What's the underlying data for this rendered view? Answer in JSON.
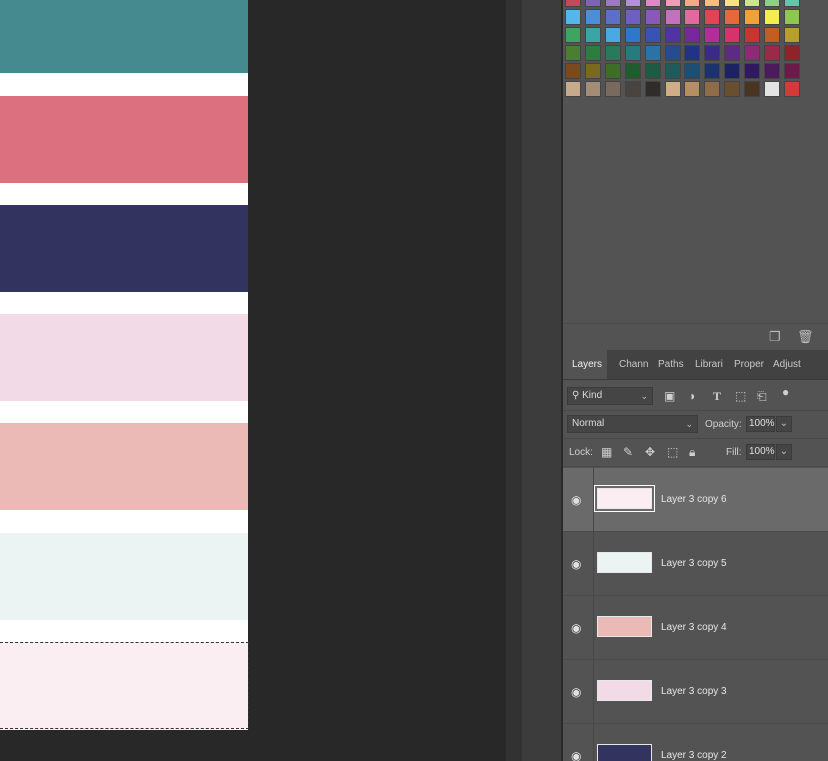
{
  "canvas": {
    "bands": [
      {
        "color": "#458a8e"
      },
      {
        "color": "#dd707e"
      },
      {
        "color": "#32335e"
      },
      {
        "color": "#f2dbe6"
      },
      {
        "color": "#ebbab6"
      },
      {
        "color": "#ebf3f3"
      },
      {
        "color": "#faeef2"
      }
    ]
  },
  "swatches": {
    "rows": [
      [
        "#c24a5a",
        "#7f63b4",
        "#9b7ac0",
        "#b38fd3",
        "#dd8ac4",
        "#f29ab7",
        "#f6a78a",
        "#f5c078",
        "#f8e37f",
        "#cde391",
        "#8fcf8a",
        "#61c7ac"
      ],
      [
        "#55b6e9",
        "#4c8fd6",
        "#5d6fc7",
        "#6f5fbe",
        "#8a58b7",
        "#c46fc0",
        "#e06a9b",
        "#e04556",
        "#e6683d",
        "#efa239",
        "#f3ed4e",
        "#8ec653"
      ],
      [
        "#3fa460",
        "#3aa5a4",
        "#48a9e3",
        "#2f78c9",
        "#3853b6",
        "#5034a5",
        "#77299c",
        "#b22c9a",
        "#d8326c",
        "#c7352e",
        "#c25d24",
        "#b89e2d"
      ],
      [
        "#4b7e2e",
        "#2b7d40",
        "#287a5b",
        "#277a7e",
        "#2a73a7",
        "#234d8f",
        "#223385",
        "#3b2a86",
        "#5d2a84",
        "#8c2a73",
        "#9b2a4a",
        "#8e2427"
      ],
      [
        "#7b4a1c",
        "#7a6a1d",
        "#3e6d26",
        "#1f5d2e",
        "#1e5b45",
        "#1e5b5d",
        "#1d4f75",
        "#1b326a",
        "#1b2362",
        "#31195f",
        "#4d1a5e",
        "#6c1a4a"
      ],
      [
        "#c7a98b",
        "#a38d77",
        "#7a6a5e",
        "#4a4440",
        "#2f2c2a",
        "#cfae85",
        "#b58e62",
        "#8e6c48",
        "#6a4e30",
        "#4a3520",
        "#e3e3e3",
        "#d33a3a"
      ]
    ]
  },
  "layers_panel": {
    "tabs": [
      "Layers",
      "Chann",
      "Paths",
      "Librari",
      "Proper",
      "Adjust"
    ],
    "filter": {
      "kind_label": "Kind"
    },
    "blend_mode": "Normal",
    "opacity_label": "Opacity:",
    "opacity_value": "100%",
    "lock_label": "Lock:",
    "fill_label": "Fill:",
    "fill_value": "100%",
    "layers": [
      {
        "name": "Layer 3 copy 6",
        "thumb_color": "#faeef2",
        "selected": true
      },
      {
        "name": "Layer 3 copy 5",
        "thumb_color": "#ebf3f3",
        "selected": false
      },
      {
        "name": "Layer 3 copy 4",
        "thumb_color": "#ebbab6",
        "selected": false
      },
      {
        "name": "Layer 3 copy 3",
        "thumb_color": "#f2dbe6",
        "selected": false
      },
      {
        "name": "Layer 3 copy 2",
        "thumb_color": "#32335e",
        "selected": false
      }
    ]
  }
}
